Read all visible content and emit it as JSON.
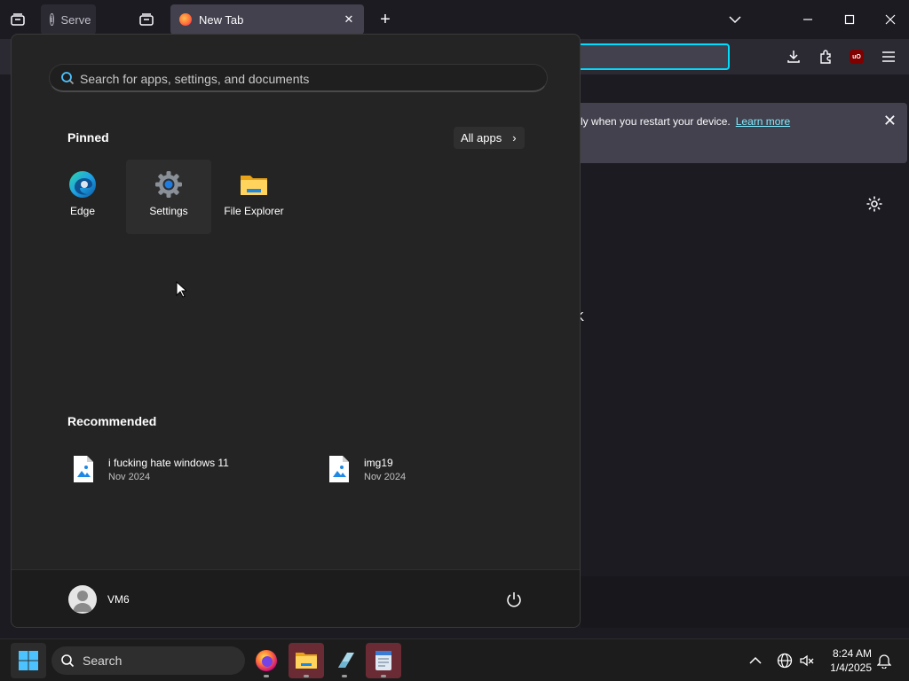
{
  "browser": {
    "inactive_tab_label": "Serve",
    "active_tab_label": "New Tab",
    "notification_text": "ly when you restart your device.",
    "notification_link": "Learn more",
    "partial_glyph": "K"
  },
  "start_menu": {
    "search_placeholder": "Search for apps, settings, and documents",
    "pinned_title": "Pinned",
    "all_apps_label": "All apps",
    "pinned": [
      {
        "label": "Edge",
        "icon": "edge-icon"
      },
      {
        "label": "Settings",
        "icon": "settings-gear-icon"
      },
      {
        "label": "File Explorer",
        "icon": "folder-icon"
      }
    ],
    "recommended_title": "Recommended",
    "recommended": [
      {
        "name": "i fucking hate windows 11",
        "date": "Nov 2024",
        "icon": "image-file-icon"
      },
      {
        "name": "img19",
        "date": "Nov 2024",
        "icon": "image-file-icon"
      }
    ],
    "user_name": "VM6"
  },
  "taskbar": {
    "search_label": "Search",
    "time": "8:24 AM",
    "date": "1/4/2025"
  },
  "colors": {
    "accent": "#00ddff",
    "start_bg": "#242424",
    "taskbar_bg": "#1c1c1c"
  }
}
